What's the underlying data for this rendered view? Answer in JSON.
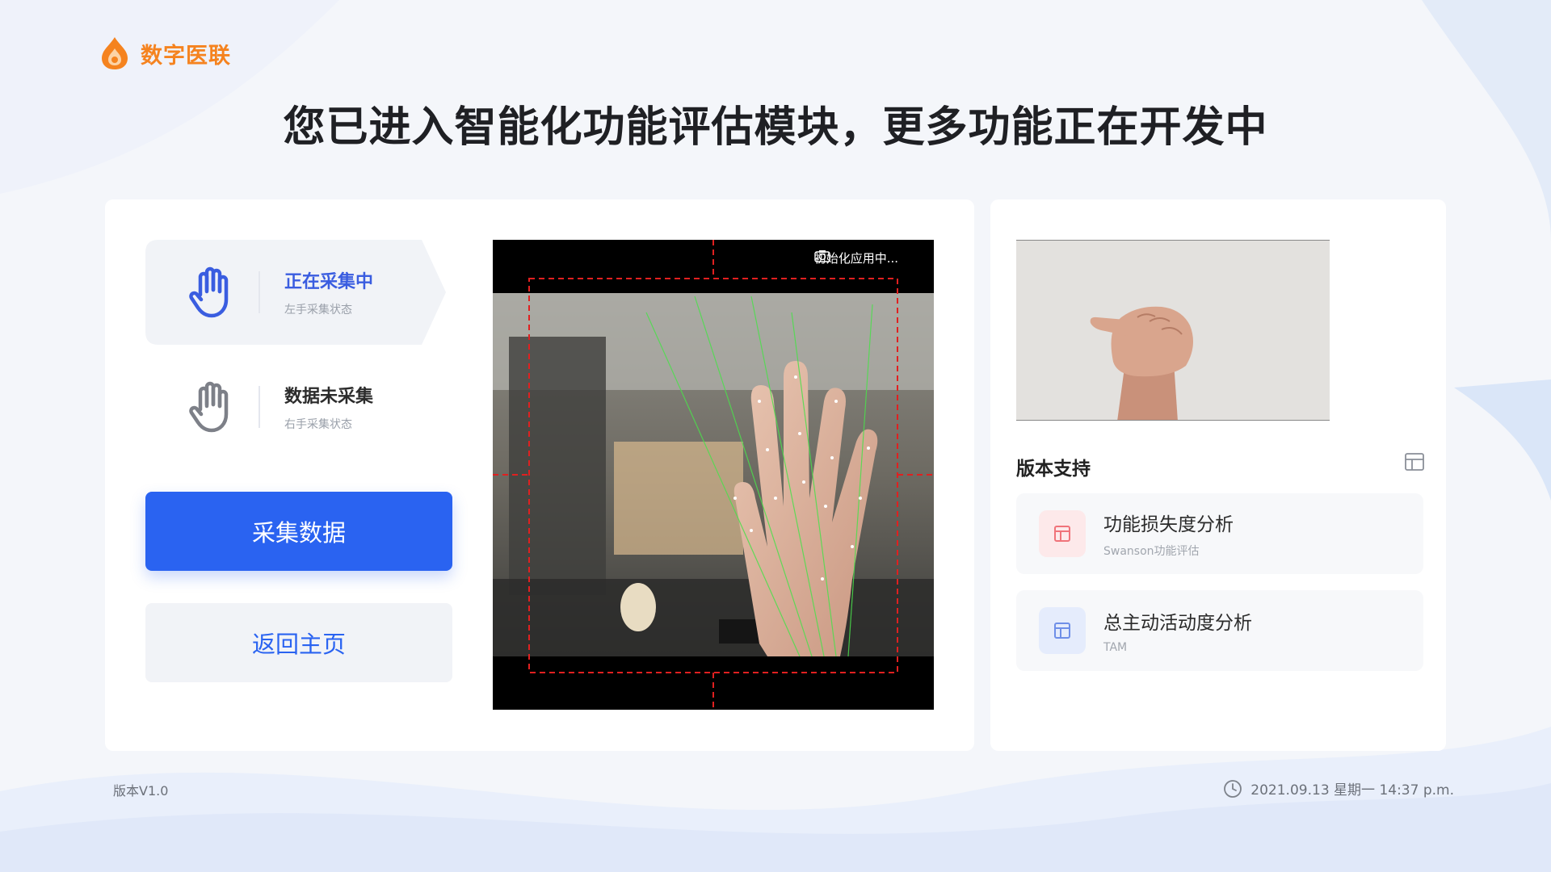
{
  "brand": {
    "name": "数字医联",
    "logo_icon": "flame-drop-logo",
    "color": "#f5831f"
  },
  "headline": "您已进入智能化功能评估模块，更多功能正在开发中",
  "left_panel": {
    "status_active": {
      "title": "正在采集中",
      "subtitle": "左手采集状态",
      "icon": "hand-icon",
      "color": "#3a5de0"
    },
    "status_idle": {
      "title": "数据未采集",
      "subtitle": "右手采集状态",
      "icon": "hand-icon"
    },
    "collect_button": "采集数据",
    "home_button": "返回主页",
    "camera": {
      "status_text": "初始化应用中..."
    }
  },
  "right_panel": {
    "section_title": "版本支持",
    "items": [
      {
        "name": "功能损失度分析",
        "desc": "Swanson功能评估",
        "accent": "#f0737a"
      },
      {
        "name": "总主动活动度分析",
        "desc": "TAM",
        "accent": "#6f8fe8"
      }
    ]
  },
  "footer": {
    "version": "版本V1.0",
    "datetime": "2021.09.13 星期一 14:37 p.m."
  },
  "colors": {
    "primary": "#2a63f1",
    "background": "#f4f6fa"
  }
}
